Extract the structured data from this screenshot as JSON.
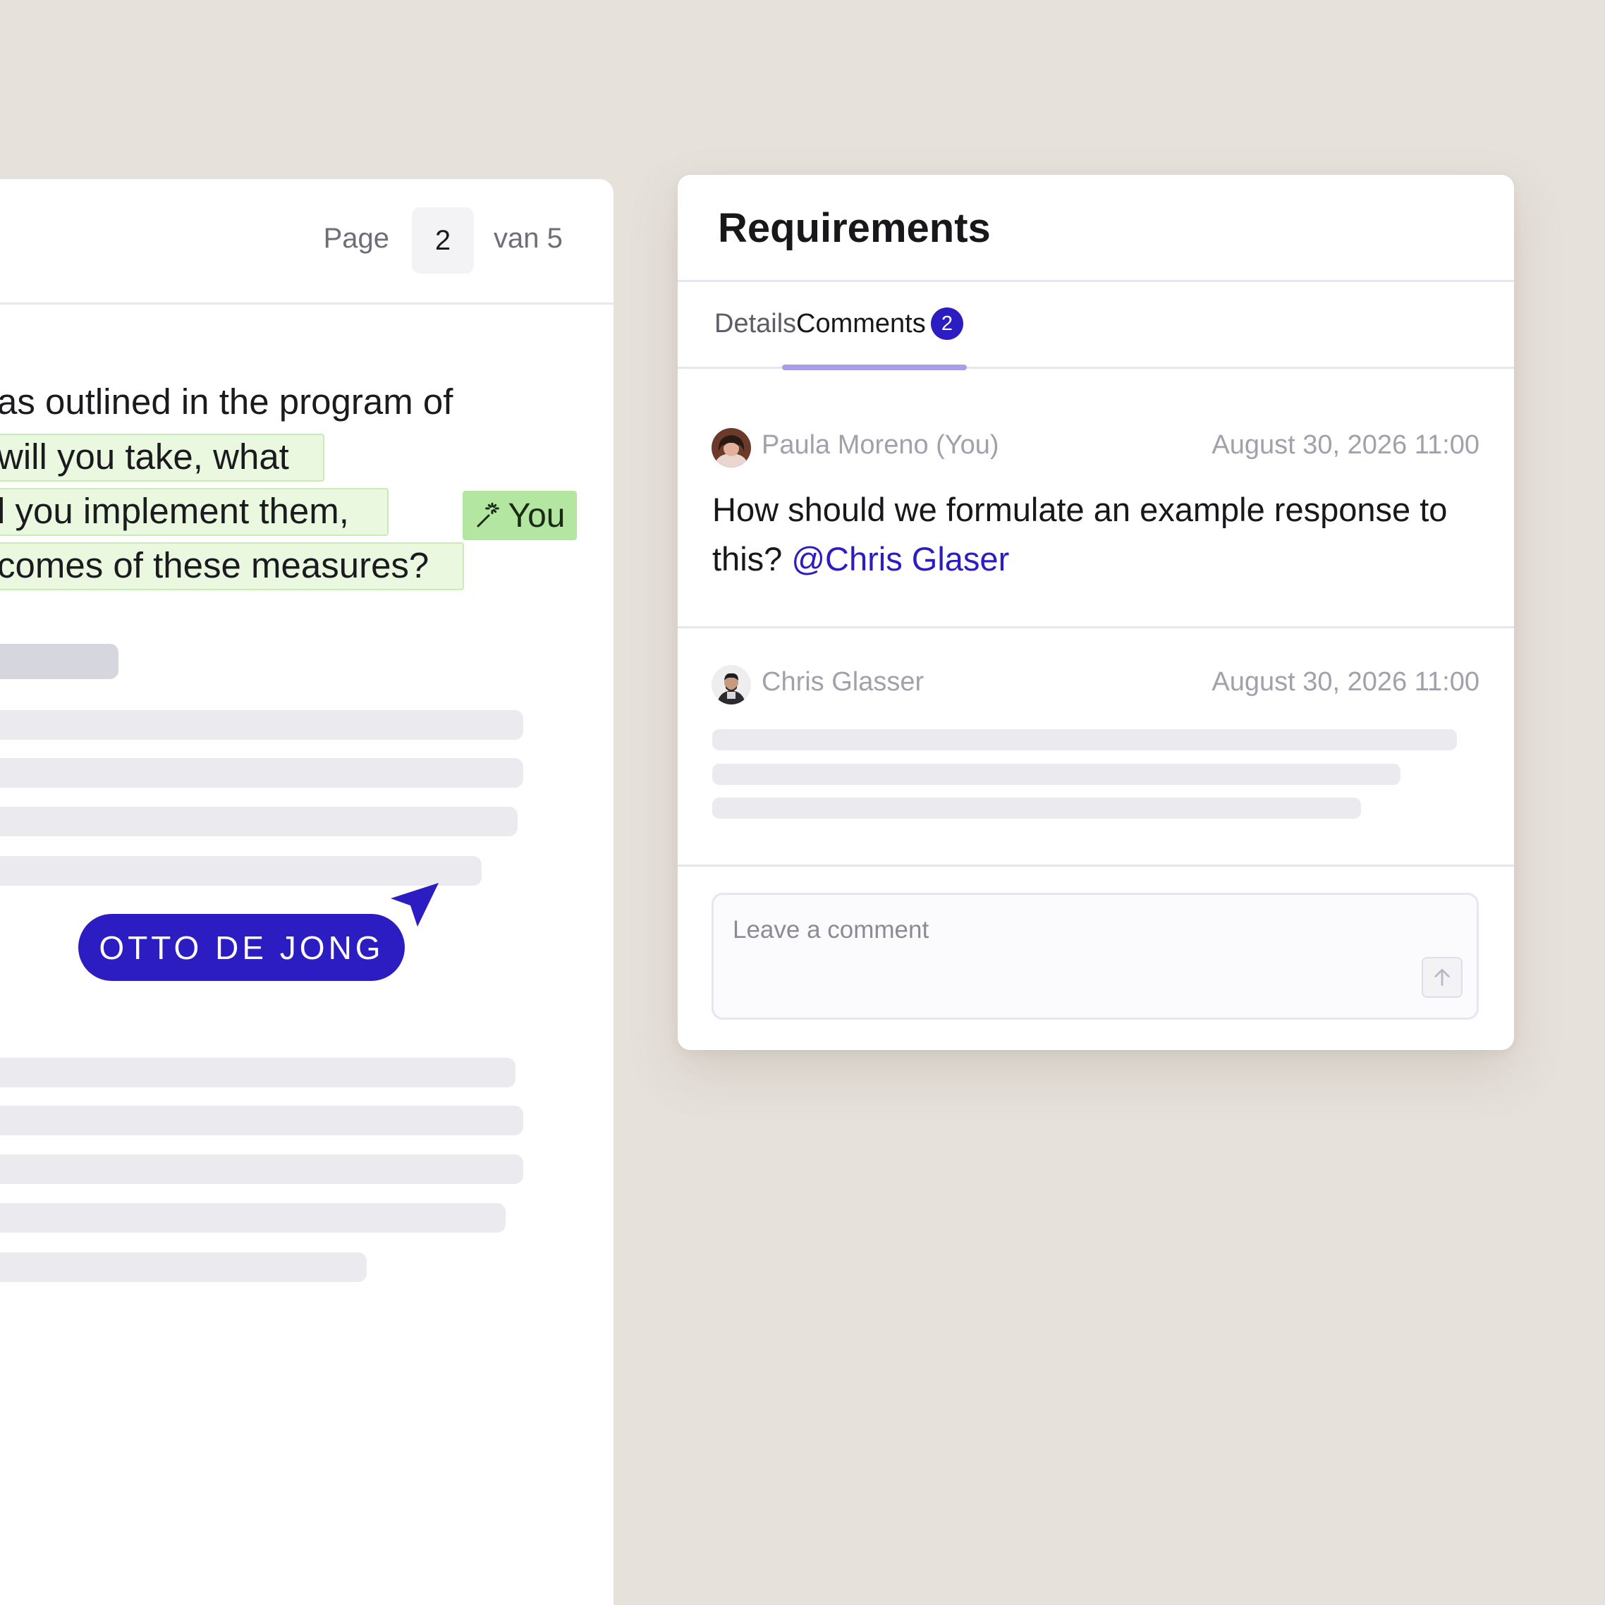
{
  "document": {
    "pagination": {
      "page_label": "Page",
      "current_page": "2",
      "total_label": "van 5"
    },
    "text_lines": [
      "as outlined in the program of",
      " will you take, what",
      "l you implement them,",
      "comes of these measures?"
    ],
    "edit_tag": {
      "label": "You",
      "icon": "magic-wand-edit-icon"
    },
    "collaborator_cursor": {
      "name": "OTTO DE JONG",
      "icon": "cursor-arrow-icon"
    }
  },
  "requirements_panel": {
    "title": "Requirements",
    "tabs": [
      {
        "label": "Details",
        "active": false
      },
      {
        "label": "Comments",
        "active": true,
        "count": "2"
      }
    ],
    "comments": [
      {
        "author": "Paula Moreno (You)",
        "timestamp": "August 30, 2026 11:00",
        "body": "How should we formulate an example response to this? ",
        "mention": "@Chris Glaser"
      },
      {
        "author": "Chris Glasser",
        "timestamp": "August 30, 2026 11:00"
      }
    ],
    "comment_input": {
      "placeholder": "Leave a comment",
      "value": "",
      "send_icon": "arrow-up-icon"
    }
  },
  "colors": {
    "accent": "#2b1dc1",
    "highlight_bg": "#e9f8df",
    "edit_tag_bg": "#b3e6a0",
    "tab_underline": "#a79ee9",
    "page_background": "#e6e1db"
  }
}
